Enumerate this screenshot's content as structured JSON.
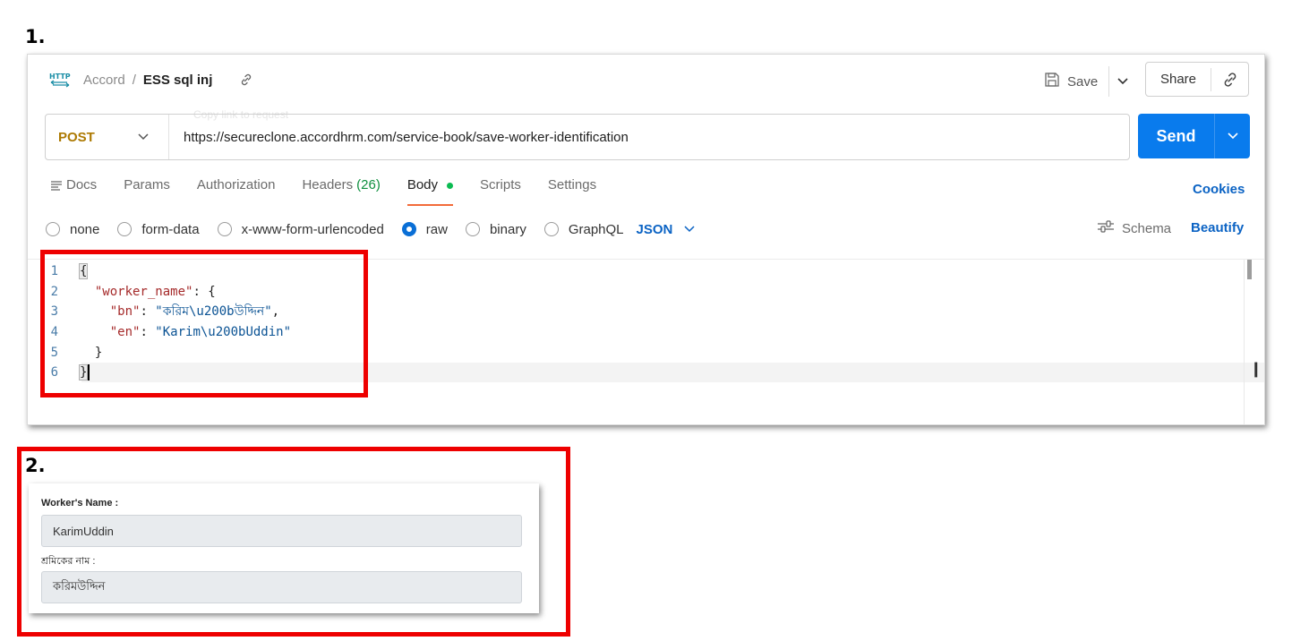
{
  "steps": {
    "first": "1.",
    "second": "2."
  },
  "request": {
    "collection": "Accord",
    "separator": "/",
    "name": "ESS sql inj",
    "ghost_tooltip": "Copy link to request",
    "save_label": "Save",
    "share_label": "Share",
    "method": "POST",
    "url": "https://secureclone.accordhrm.com/service-book/save-worker-identification",
    "send_label": "Send"
  },
  "tabs": [
    {
      "label": "Docs"
    },
    {
      "label": "Params"
    },
    {
      "label": "Authorization"
    },
    {
      "label": "Headers",
      "count": "(26)"
    },
    {
      "label": "Body",
      "active": true
    },
    {
      "label": "Scripts"
    },
    {
      "label": "Settings"
    }
  ],
  "cookies_label": "Cookies",
  "body_options": {
    "none": "none",
    "form_data": "form-data",
    "urlencoded": "x-www-form-urlencoded",
    "raw": "raw",
    "binary": "binary",
    "graphql": "GraphQL",
    "selected": "raw",
    "format": "JSON"
  },
  "schema_label": "Schema",
  "beautify_label": "Beautify",
  "editor": {
    "line_numbers": [
      "1",
      "2",
      "3",
      "4",
      "5",
      "6"
    ],
    "key_worker_name": "\"worker_name\"",
    "key_bn": "\"bn\"",
    "val_bn": "\"করিম\\u200bউদ্দিন\"",
    "key_en": "\"en\"",
    "val_en": "\"Karim\\u200bUddin\"",
    "open_brace": "{",
    "close_brace": "}",
    "colon_open": ": {",
    "colon": ": ",
    "comma": ","
  },
  "form": {
    "name_en_label": "Worker's Name :",
    "name_en_value": "KarimUddin",
    "name_bn_label": "শ্রমিকের নাম :",
    "name_bn_value": "করিমউদ্দিন"
  },
  "colors": {
    "send": "#097bed",
    "method": "#ad7a03",
    "link": "#0b63c4",
    "highlight_box": "#ee0000",
    "active_tab_underline": "#f26b3a"
  }
}
